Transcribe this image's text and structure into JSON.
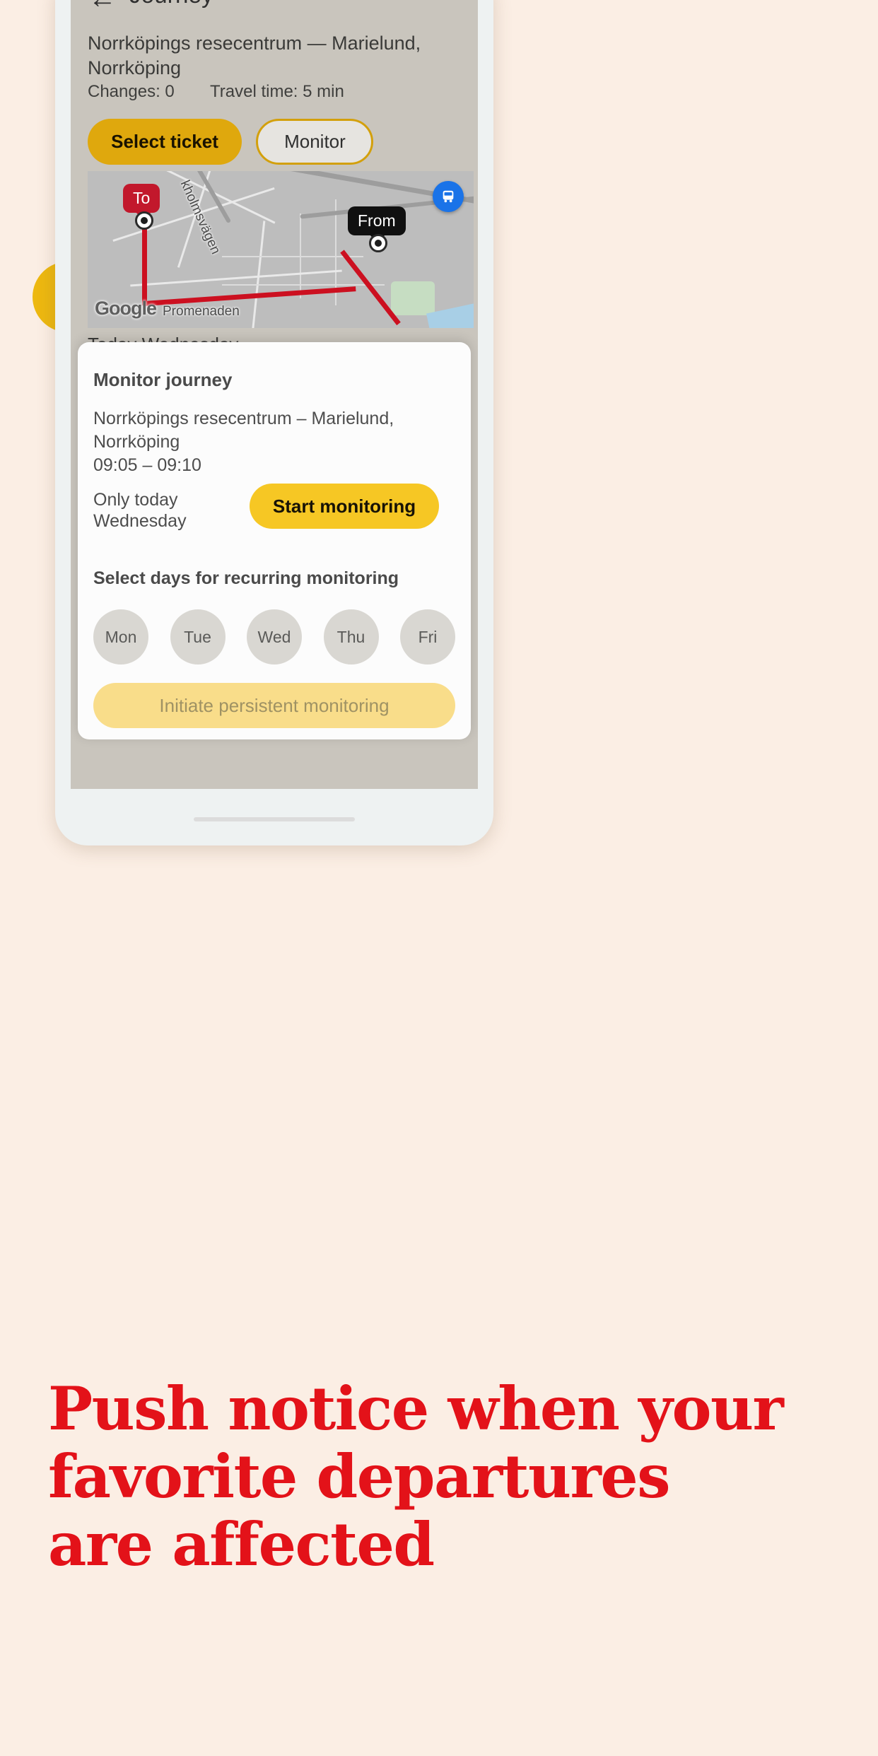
{
  "page": {
    "background_color": "#fbeee4",
    "accent_yellow": "#edb810",
    "headline_color": "#e31219"
  },
  "headline": {
    "lines": [
      "Push notice when your",
      "favorite departures",
      "are affected"
    ]
  },
  "phone": {
    "app": {
      "header": {
        "back_icon": "arrow-left-icon",
        "back_glyph": "←",
        "title": "Journey"
      },
      "journey": {
        "route": "Norrköpings resecentrum — Marielund, Norrköping",
        "changes": "Changes: 0",
        "travel_time": "Travel time: 5 min"
      },
      "actions": {
        "select_ticket": "Select ticket",
        "monitor": "Monitor"
      },
      "map": {
        "to_label": "To",
        "from_label": "From",
        "watermark": "Google",
        "street_labels": [
          "kholmsvägen",
          "Promenaden"
        ],
        "bus_icon": "bus-icon",
        "bus_glyph": "🚌"
      },
      "behind_sheet_text": "Today Wednesday"
    },
    "sheet": {
      "title": "Monitor journey",
      "route": "Norrköpings resecentrum – Marielund, Norrköping",
      "times": "09:05 – 09:10",
      "only_today_line1": "Only today",
      "only_today_line2": "Wednesday",
      "start_button": "Start monitoring",
      "select_days_label": "Select days for recurring monitoring",
      "days": [
        {
          "label": "Mon",
          "selected": false
        },
        {
          "label": "Tue",
          "selected": false
        },
        {
          "label": "Wed",
          "selected": false
        },
        {
          "label": "Thu",
          "selected": false
        },
        {
          "label": "Fri",
          "selected": false
        }
      ],
      "initiate_button": "Initiate persistent monitoring"
    }
  }
}
